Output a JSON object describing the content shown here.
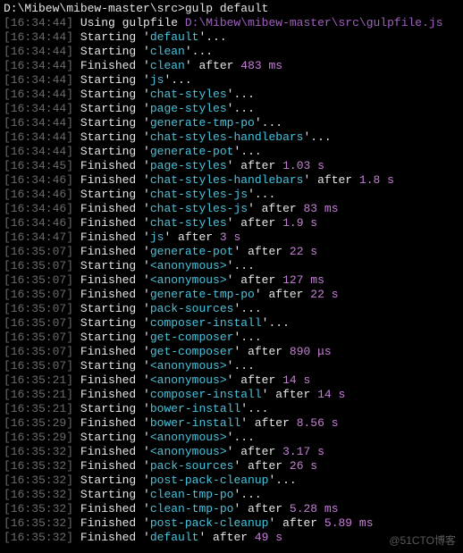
{
  "prompt": {
    "path": "D:\\Mibew\\mibew-master\\src>",
    "command": "gulp default"
  },
  "gulpfile_prefix": "Using gulpfile",
  "gulpfile_path": "D:\\Mibew\\mibew-master\\src\\gulpfile.js",
  "labels": {
    "starting": "Starting",
    "finished": "Finished",
    "after": "after"
  },
  "lines": [
    {
      "ts": "16:34:44",
      "type": "gulpfile"
    },
    {
      "ts": "16:34:44",
      "type": "start",
      "task": "default"
    },
    {
      "ts": "16:34:44",
      "type": "start",
      "task": "clean"
    },
    {
      "ts": "16:34:44",
      "type": "finish",
      "task": "clean",
      "dur": "483 ms"
    },
    {
      "ts": "16:34:44",
      "type": "start",
      "task": "js"
    },
    {
      "ts": "16:34:44",
      "type": "start",
      "task": "chat-styles"
    },
    {
      "ts": "16:34:44",
      "type": "start",
      "task": "page-styles"
    },
    {
      "ts": "16:34:44",
      "type": "start",
      "task": "generate-tmp-po"
    },
    {
      "ts": "16:34:44",
      "type": "start",
      "task": "chat-styles-handlebars"
    },
    {
      "ts": "16:34:44",
      "type": "start",
      "task": "generate-pot"
    },
    {
      "ts": "16:34:45",
      "type": "finish",
      "task": "page-styles",
      "dur": "1.03 s"
    },
    {
      "ts": "16:34:46",
      "type": "finish",
      "task": "chat-styles-handlebars",
      "dur": "1.8 s"
    },
    {
      "ts": "16:34:46",
      "type": "start",
      "task": "chat-styles-js"
    },
    {
      "ts": "16:34:46",
      "type": "finish",
      "task": "chat-styles-js",
      "dur": "83 ms"
    },
    {
      "ts": "16:34:46",
      "type": "finish",
      "task": "chat-styles",
      "dur": "1.9 s"
    },
    {
      "ts": "16:34:47",
      "type": "finish",
      "task": "js",
      "dur": "3 s"
    },
    {
      "ts": "16:35:07",
      "type": "finish",
      "task": "generate-pot",
      "dur": "22 s"
    },
    {
      "ts": "16:35:07",
      "type": "start",
      "task": "<anonymous>"
    },
    {
      "ts": "16:35:07",
      "type": "finish",
      "task": "<anonymous>",
      "dur": "127 ms"
    },
    {
      "ts": "16:35:07",
      "type": "finish",
      "task": "generate-tmp-po",
      "dur": "22 s"
    },
    {
      "ts": "16:35:07",
      "type": "start",
      "task": "pack-sources"
    },
    {
      "ts": "16:35:07",
      "type": "start",
      "task": "composer-install"
    },
    {
      "ts": "16:35:07",
      "type": "start",
      "task": "get-composer"
    },
    {
      "ts": "16:35:07",
      "type": "finish",
      "task": "get-composer",
      "dur": "890 μs"
    },
    {
      "ts": "16:35:07",
      "type": "start",
      "task": "<anonymous>"
    },
    {
      "ts": "16:35:21",
      "type": "finish",
      "task": "<anonymous>",
      "dur": "14 s"
    },
    {
      "ts": "16:35:21",
      "type": "finish",
      "task": "composer-install",
      "dur": "14 s"
    },
    {
      "ts": "16:35:21",
      "type": "start",
      "task": "bower-install"
    },
    {
      "ts": "16:35:29",
      "type": "finish",
      "task": "bower-install",
      "dur": "8.56 s"
    },
    {
      "ts": "16:35:29",
      "type": "start",
      "task": "<anonymous>"
    },
    {
      "ts": "16:35:32",
      "type": "finish",
      "task": "<anonymous>",
      "dur": "3.17 s"
    },
    {
      "ts": "16:35:32",
      "type": "finish",
      "task": "pack-sources",
      "dur": "26 s"
    },
    {
      "ts": "16:35:32",
      "type": "start",
      "task": "post-pack-cleanup"
    },
    {
      "ts": "16:35:32",
      "type": "start",
      "task": "clean-tmp-po"
    },
    {
      "ts": "16:35:32",
      "type": "finish",
      "task": "clean-tmp-po",
      "dur": "5.28 ms"
    },
    {
      "ts": "16:35:32",
      "type": "finish",
      "task": "post-pack-cleanup",
      "dur": "5.89 ms"
    },
    {
      "ts": "16:35:32",
      "type": "finish",
      "task": "default",
      "dur": "49 s"
    }
  ],
  "watermark": "@51CTO博客"
}
